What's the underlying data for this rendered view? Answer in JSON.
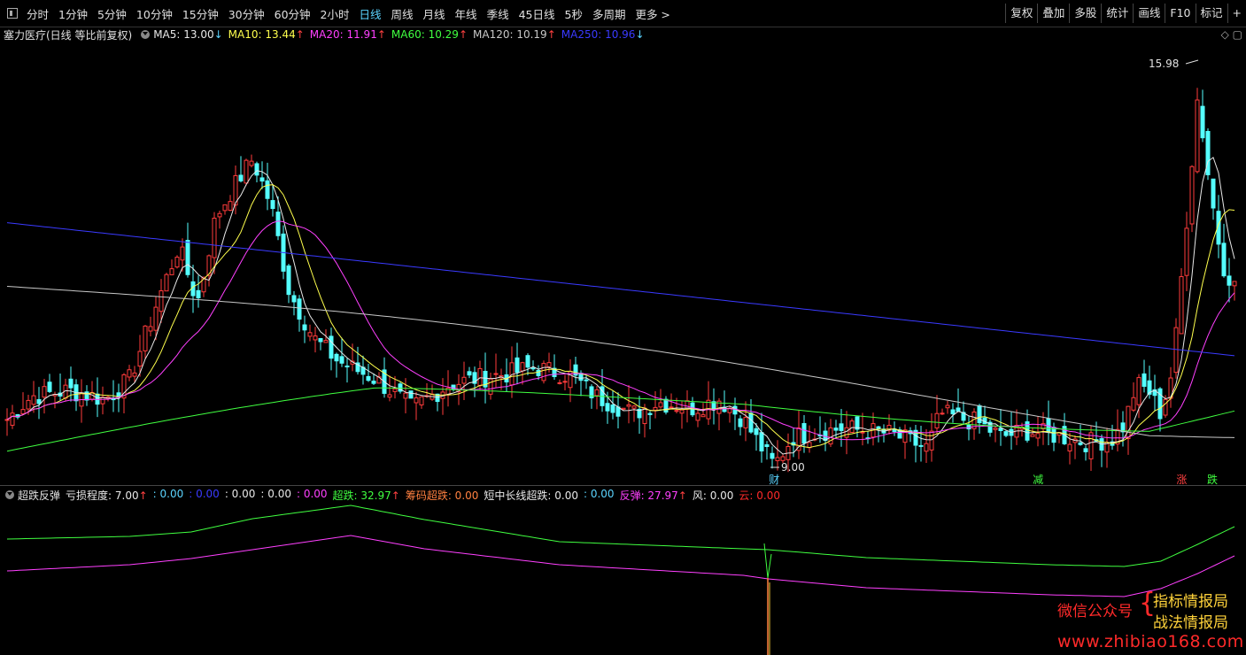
{
  "toolbar": {
    "periods": [
      "分时",
      "1分钟",
      "5分钟",
      "10分钟",
      "15分钟",
      "30分钟",
      "60分钟",
      "2小时",
      "日线",
      "周线",
      "月线",
      "年线",
      "季线",
      "45日线",
      "5秒",
      "多周期",
      "更多 >"
    ],
    "active_period": "日线",
    "tools": [
      "复权",
      "叠加",
      "多股",
      "统计",
      "画线",
      "F10",
      "标记",
      "+"
    ]
  },
  "main_header": {
    "stock_name": "塞力医疗(日线 等比前复权)",
    "ma": [
      {
        "label": "MA5: 13.00",
        "arrow": "↓",
        "color": "#e8e8e8",
        "arrow_color": "#5bd4ff"
      },
      {
        "label": "MA10: 13.44",
        "arrow": "↑",
        "color": "#ffff4d",
        "arrow_color": "#ff4040"
      },
      {
        "label": "MA20: 11.91",
        "arrow": "↑",
        "color": "#ff40ff",
        "arrow_color": "#ff4040"
      },
      {
        "label": "MA60: 10.29",
        "arrow": "↑",
        "color": "#40ff40",
        "arrow_color": "#ff4040"
      },
      {
        "label": "MA120: 10.19",
        "arrow": "↑",
        "color": "#c8c8c8",
        "arrow_color": "#ff4040"
      },
      {
        "label": "MA250: 10.96",
        "arrow": "↓",
        "color": "#3a3aff",
        "arrow_color": "#5bd4ff"
      }
    ]
  },
  "price_labels": {
    "high": "15.98",
    "low": "9.00"
  },
  "event_marks": [
    {
      "text": "财",
      "color": "#5bd4ff",
      "pos": 0.625
    },
    {
      "text": "减",
      "color": "#40ff40",
      "pos": 0.84
    },
    {
      "text": "涨",
      "color": "#ff4040",
      "pos": 0.957
    },
    {
      "text": "跌",
      "color": "#40ff40",
      "pos": 0.982
    }
  ],
  "sub_header": {
    "name": "超跌反弹",
    "items": [
      {
        "label": "亏损程度: 7.00",
        "color": "#e8e8e8",
        "arrow": "↑",
        "arrow_color": "#ff4040"
      },
      {
        "label": ": 0.00",
        "color": "#5bd4ff"
      },
      {
        "label": ": 0.00",
        "color": "#3a3aff"
      },
      {
        "label": ": 0.00",
        "color": "#e8e8e8"
      },
      {
        "label": ": 0.00",
        "color": "#e8e8e8"
      },
      {
        "label": ": 0.00",
        "color": "#ff40ff"
      },
      {
        "label": "超跌: 32.97",
        "color": "#40ff40",
        "arrow": "↑",
        "arrow_color": "#ff4040"
      },
      {
        "label": "筹码超跌: 0.00",
        "color": "#ff8040"
      },
      {
        "label": "短中长线超跌: 0.00",
        "color": "#e8e8e8"
      },
      {
        "label": ": 0.00",
        "color": "#5bd4ff"
      },
      {
        "label": "反弹: 27.97",
        "color": "#ff40ff",
        "arrow": "↑",
        "arrow_color": "#ff4040"
      },
      {
        "label": "风: 0.00",
        "color": "#e8e8e8"
      },
      {
        "label": "云: 0.00",
        "color": "#ff2a2a"
      }
    ]
  },
  "watermark": {
    "left": "微信公众号",
    "right1": "指标情报局",
    "right2": "战法情报局",
    "url": "www.zhibiao168.com"
  },
  "colors": {
    "up": "#ff3b3b",
    "down": "#54ffff",
    "ma5": "#e8e8e8",
    "ma10": "#ffff4d",
    "ma20": "#ff40ff",
    "ma60": "#40ff40",
    "ma120": "#c8c8c8",
    "ma250": "#3a3aff"
  }
}
